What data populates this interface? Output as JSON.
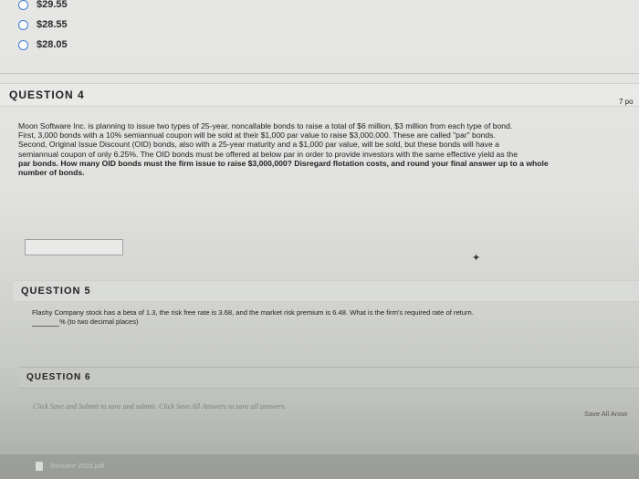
{
  "previous_question": {
    "options": [
      "$29.55",
      "$28.55",
      "$28.05"
    ]
  },
  "question4": {
    "header": "QUESTION 4",
    "points": "7 po",
    "lines": [
      "Moon Software Inc. is planning to issue two types of 25-year, noncallable bonds to raise a total of $6 million, $3 million from each type of bond.",
      "First, 3,000 bonds with a 10% semiannual coupon will be sold at their $1,000 par value to raise $3,000,000.  These are called \"par\" bonds.",
      "Second, Original Issue Discount (OID) bonds, also with a 25-year maturity and a $1,000 par value, will be sold, but these bonds will have a",
      "semiannual coupon of only 6.25%.  The OID bonds must be offered at below par in order to provide investors with the same effective yield as the",
      "par bonds.  How many OID bonds must the firm issue to raise $3,000,000?  Disregard flotation costs, and round your final answer up to a whole",
      "number of bonds."
    ],
    "answer_value": ""
  },
  "question5": {
    "header": "QUESTION 5",
    "text_line1": "Flashy Company stock has a beta of 1.3, the risk free rate is 3.68, and the market risk premium is 6.48.  What is the firm's required rate of return.",
    "text_line2": "% (to two decimal places)",
    "answer_value": ""
  },
  "question6": {
    "header": "QUESTION 6"
  },
  "footer": {
    "instructions": "Click Save and Submit to save and submit. Click Save All Answers to save all answers.",
    "save_all_button": "Save All Answ"
  },
  "taskbar": {
    "file_name": "Resume 2020.pdf"
  },
  "colors": {
    "radio_border": "#3f7ed0",
    "background": "#e3e3e1"
  }
}
